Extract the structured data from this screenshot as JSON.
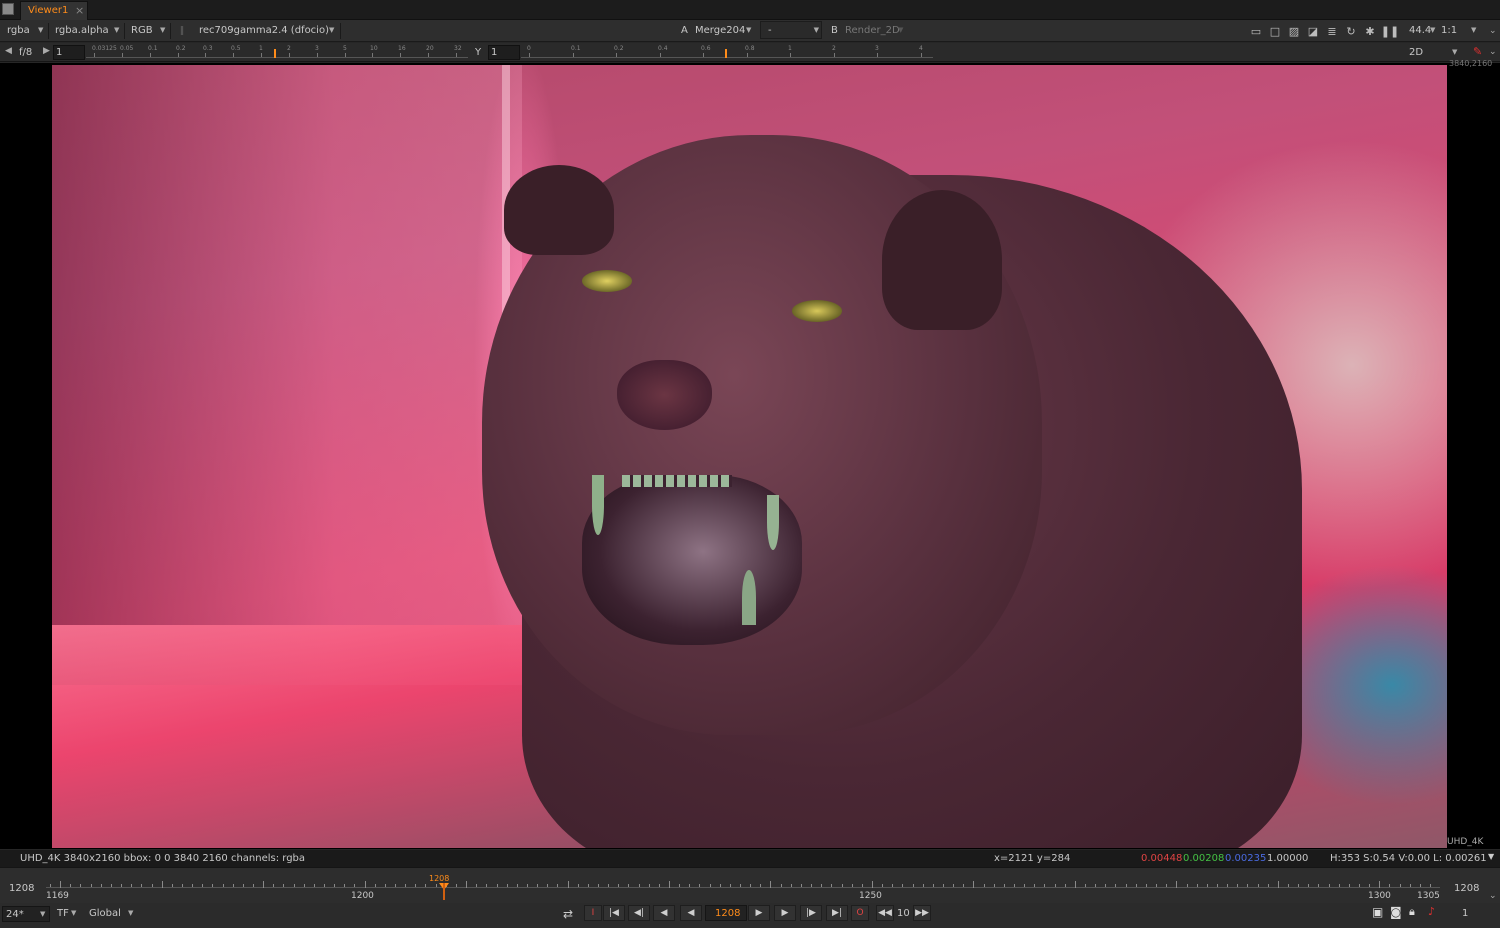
{
  "tab": {
    "title": "Viewer1",
    "close": "×"
  },
  "toolbar1": {
    "channels": "rgba",
    "alpha": "rgba.alpha",
    "display": "RGB",
    "colorspace": "rec709gamma2.4 (dfocio)",
    "input_a_label": "A",
    "input_a": "Merge204",
    "compare": "-",
    "input_b_label": "B",
    "input_b": "Render_2D",
    "zoom": "44.4",
    "ratio": "1:1"
  },
  "toolbar2": {
    "fstop": "f/8",
    "gain": "1",
    "gamma_label": "Y",
    "gamma": "1",
    "gain_ticks": [
      "0.03125",
      "0.05",
      "0.1",
      "0.2",
      "0.3",
      "0.5",
      "1",
      "2",
      "3",
      "5",
      "10",
      "16",
      "20",
      "32"
    ],
    "gamma_ticks": [
      "0",
      "0.1",
      "0.2",
      "0.4",
      "0.6",
      "0.8",
      "1",
      "2",
      "3",
      "4"
    ],
    "view_mode": "2D"
  },
  "viewer": {
    "format_corner_top": "3840,2160",
    "format_corner_bottom": "UHD_4K",
    "subject": "panther"
  },
  "info_bar": {
    "format": "UHD_4K 3840x2160  bbox: 0 0 3840 2160 channels: rgba",
    "coords": "x=2121 y=284",
    "r": "0.00448",
    "g": "0.00208",
    "b": "0.00235",
    "a": "1.00000",
    "hsvl": "H:353 S:0.54 V:0.00  L: 0.00261"
  },
  "timeline": {
    "in_frame": "1208",
    "out_frame": "1208",
    "start": "1169",
    "label_1200": "1200",
    "label_1250": "1250",
    "label_1300": "1300",
    "end": "1305",
    "marker": "1208"
  },
  "transport": {
    "fps": "24*",
    "tf": "TF",
    "range": "Global",
    "current_frame": "1208",
    "increment": "10",
    "playback_count": "1"
  },
  "colors": {
    "accent": "#ff8c1a",
    "red": "#e04444",
    "green": "#44c044",
    "blue": "#4a6adf"
  }
}
